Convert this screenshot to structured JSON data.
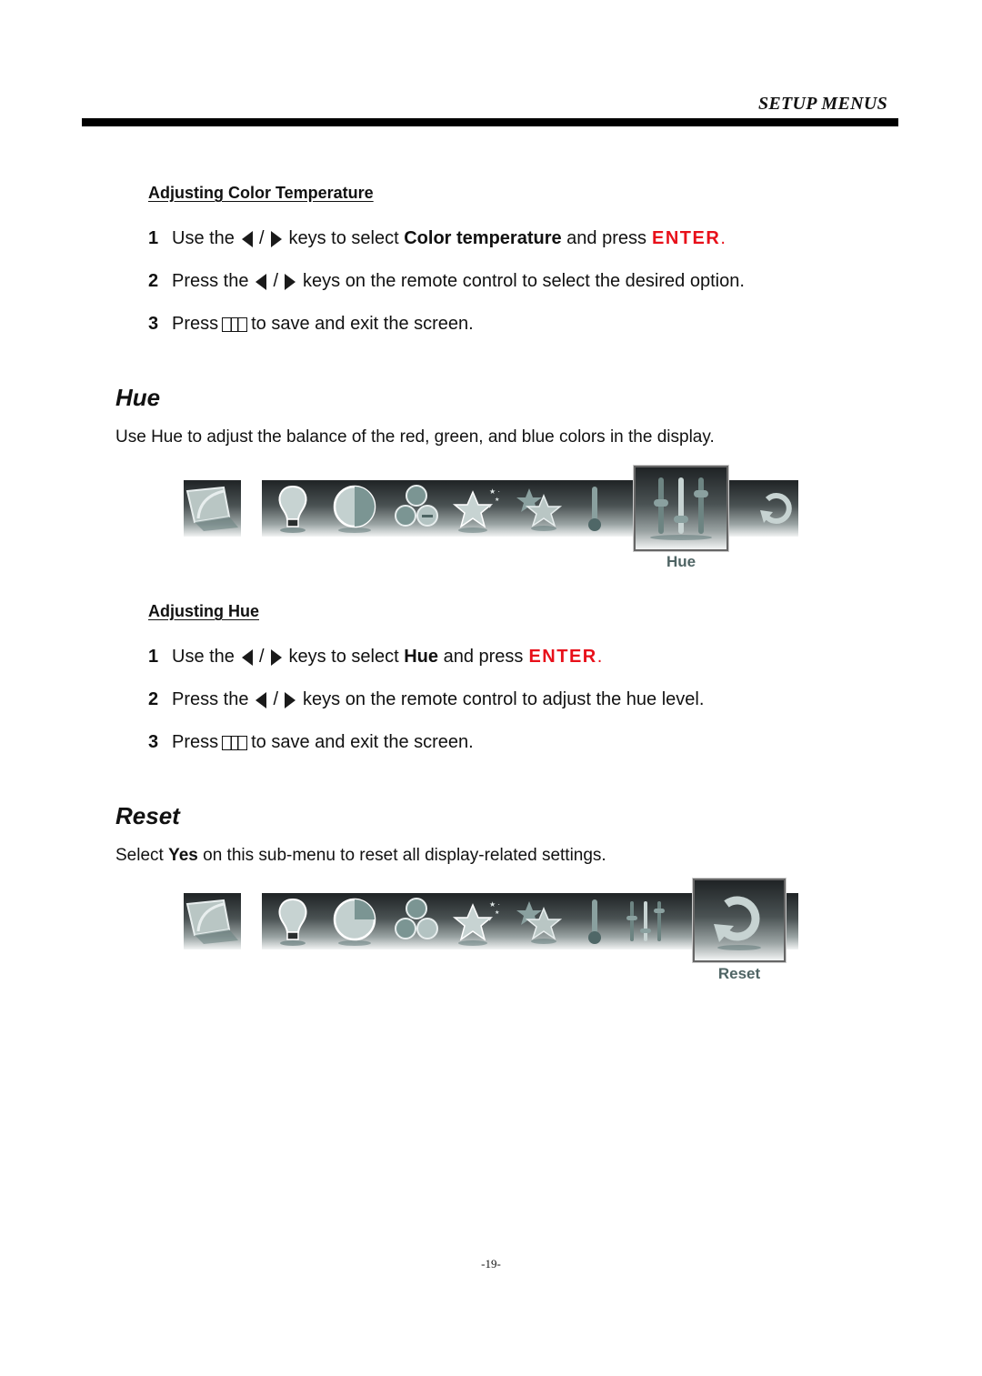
{
  "header": {
    "title": "SETUP MENUS"
  },
  "color_temp_section": {
    "heading": "Adjusting Color Temperature",
    "steps": [
      {
        "num": "1",
        "pre": "Use the",
        "sep": "/",
        "mid": "keys to select",
        "bold": "Color temperature",
        "post": "and press",
        "key": "ENTER",
        "end": "."
      },
      {
        "num": "2",
        "pre": "Press the",
        "sep": "/",
        "post": "keys on the remote control to select the desired option."
      },
      {
        "num": "3",
        "pre": "Press",
        "post": "to save and exit the screen."
      }
    ]
  },
  "hue_section": {
    "title": "Hue",
    "description": "Use Hue to adjust the balance of the red, green, and blue colors in the display.",
    "menu_bar": {
      "selected_label": "Hue",
      "icons": [
        "picture-mode-icon",
        "brightness-bulb-icon",
        "contrast-circle-icon",
        "color-balls-icon",
        "sharpness-star-icon",
        "star-pair-icon",
        "thermometer-icon",
        "hue-sliders-icon",
        "reset-icon"
      ]
    },
    "sub_heading": "Adjusting Hue",
    "steps": [
      {
        "num": "1",
        "pre": "Use the",
        "sep": "/",
        "mid": "keys to select",
        "bold": "Hue",
        "post": "and press",
        "key": "ENTER",
        "end": "."
      },
      {
        "num": "2",
        "pre": "Press the",
        "sep": "/",
        "post": "keys on the remote control to adjust the hue level."
      },
      {
        "num": "3",
        "pre": "Press",
        "post": "to save and exit the screen."
      }
    ]
  },
  "reset_section": {
    "title": "Reset",
    "desc_pre": "Select",
    "desc_bold": "Yes",
    "desc_post": "on this sub-menu to reset all display-related settings.",
    "menu_bar": {
      "selected_label": "Reset"
    }
  },
  "footer": {
    "page_number": "-19-"
  },
  "colors": {
    "enter_red": "#e8101a",
    "label_gray": "#4f6464"
  }
}
